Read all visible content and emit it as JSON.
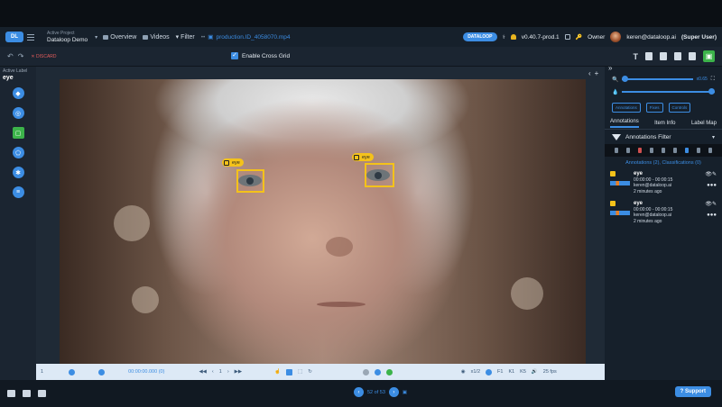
{
  "topbar": {
    "logo": "DL",
    "project_caption": "Active Project",
    "project_name": "Dataloop Demo",
    "nav": [
      {
        "label": "Overview"
      },
      {
        "label": "Videos"
      },
      {
        "label": "Filter"
      }
    ],
    "item_path": "production.ID_4058070.mp4",
    "org_badge": "DATALOOP",
    "version": "v0.40.7-prod.1",
    "role": "Owner",
    "user": "keren@dataloop.ai",
    "user_role": "(Super User)"
  },
  "toolbar": {
    "discard": "DISCARD",
    "cross_grid_label": "Enable Cross Grid",
    "cross_grid_checked": true
  },
  "left_panel": {
    "active_label_caption": "Active Label",
    "active_label": "eye",
    "tools": [
      "tag-tool",
      "point-tool",
      "box-tool",
      "polygon-tool",
      "bug-tool",
      "list-tool"
    ]
  },
  "video": {
    "annotations": [
      {
        "label": "eye"
      },
      {
        "label": "eye"
      }
    ],
    "label_color": "#f4c21a"
  },
  "right_panel": {
    "opacity_value": "x0.65",
    "buttons": [
      "Annotations",
      "Fixes",
      "Controls"
    ],
    "tabs": [
      "Annotations",
      "Item Info",
      "Label Map"
    ],
    "filter_title": "Annotations Filter",
    "count_text": "Annotations (2), Classifications (0)",
    "items": [
      {
        "label": "eye",
        "time": "00:00:00 - 00:00:15",
        "user": "keren@dataloop.ai",
        "ago": "2 minutes ago"
      },
      {
        "label": "eye",
        "time": "00:00:00 - 00:00:15",
        "user": "keren@dataloop.ai",
        "ago": "2 minutes ago"
      }
    ]
  },
  "timeline": {
    "frame": "1",
    "time": "00:00:00.000 (0)",
    "speed": "x1/2",
    "keys": [
      "F1",
      "K1",
      "K5"
    ],
    "fps": "25 fps"
  },
  "footer": {
    "page": "52 of 53",
    "support": "Support"
  },
  "colors": {
    "accent": "#3c8de3",
    "save": "#3cb34a",
    "label": "#f4c21a"
  }
}
